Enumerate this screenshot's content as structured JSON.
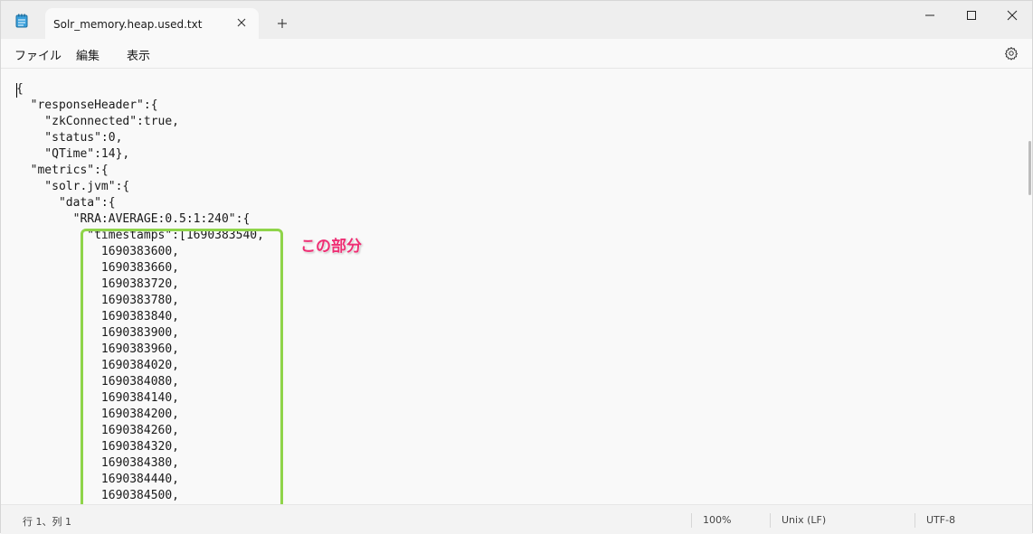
{
  "window": {
    "tab_title": "Solr_memory.heap.used.txt",
    "icons": {
      "app": "notepad-icon",
      "tab_close": "close-icon",
      "new_tab": "plus-icon",
      "minimize": "minimize-icon",
      "maximize": "maximize-icon",
      "close": "close-icon"
    }
  },
  "menubar": {
    "file": "ファイル",
    "edit": "編集",
    "view": "表示",
    "settings_icon": "gear-icon"
  },
  "editor": {
    "lines": [
      "{",
      "  \"responseHeader\":{",
      "    \"zkConnected\":true,",
      "    \"status\":0,",
      "    \"QTime\":14},",
      "  \"metrics\":{",
      "    \"solr.jvm\":{",
      "      \"data\":{",
      "        \"RRA:AVERAGE:0.5:1:240\":{",
      "          \"timestamps\":[1690383540,",
      "            1690383600,",
      "            1690383660,",
      "            1690383720,",
      "            1690383780,",
      "            1690383840,",
      "            1690383900,",
      "            1690383960,",
      "            1690384020,",
      "            1690384080,",
      "            1690384140,",
      "            1690384200,",
      "            1690384260,",
      "            1690384320,",
      "            1690384380,",
      "            1690384440,",
      "            1690384500,"
    ]
  },
  "annotation": {
    "label": "この部分",
    "box_color": "#8fd44a",
    "label_color": "#ee2f74"
  },
  "statusbar": {
    "position": "行 1、列 1",
    "zoom": "100%",
    "line_ending": "Unix (LF)",
    "encoding": "UTF-8"
  }
}
